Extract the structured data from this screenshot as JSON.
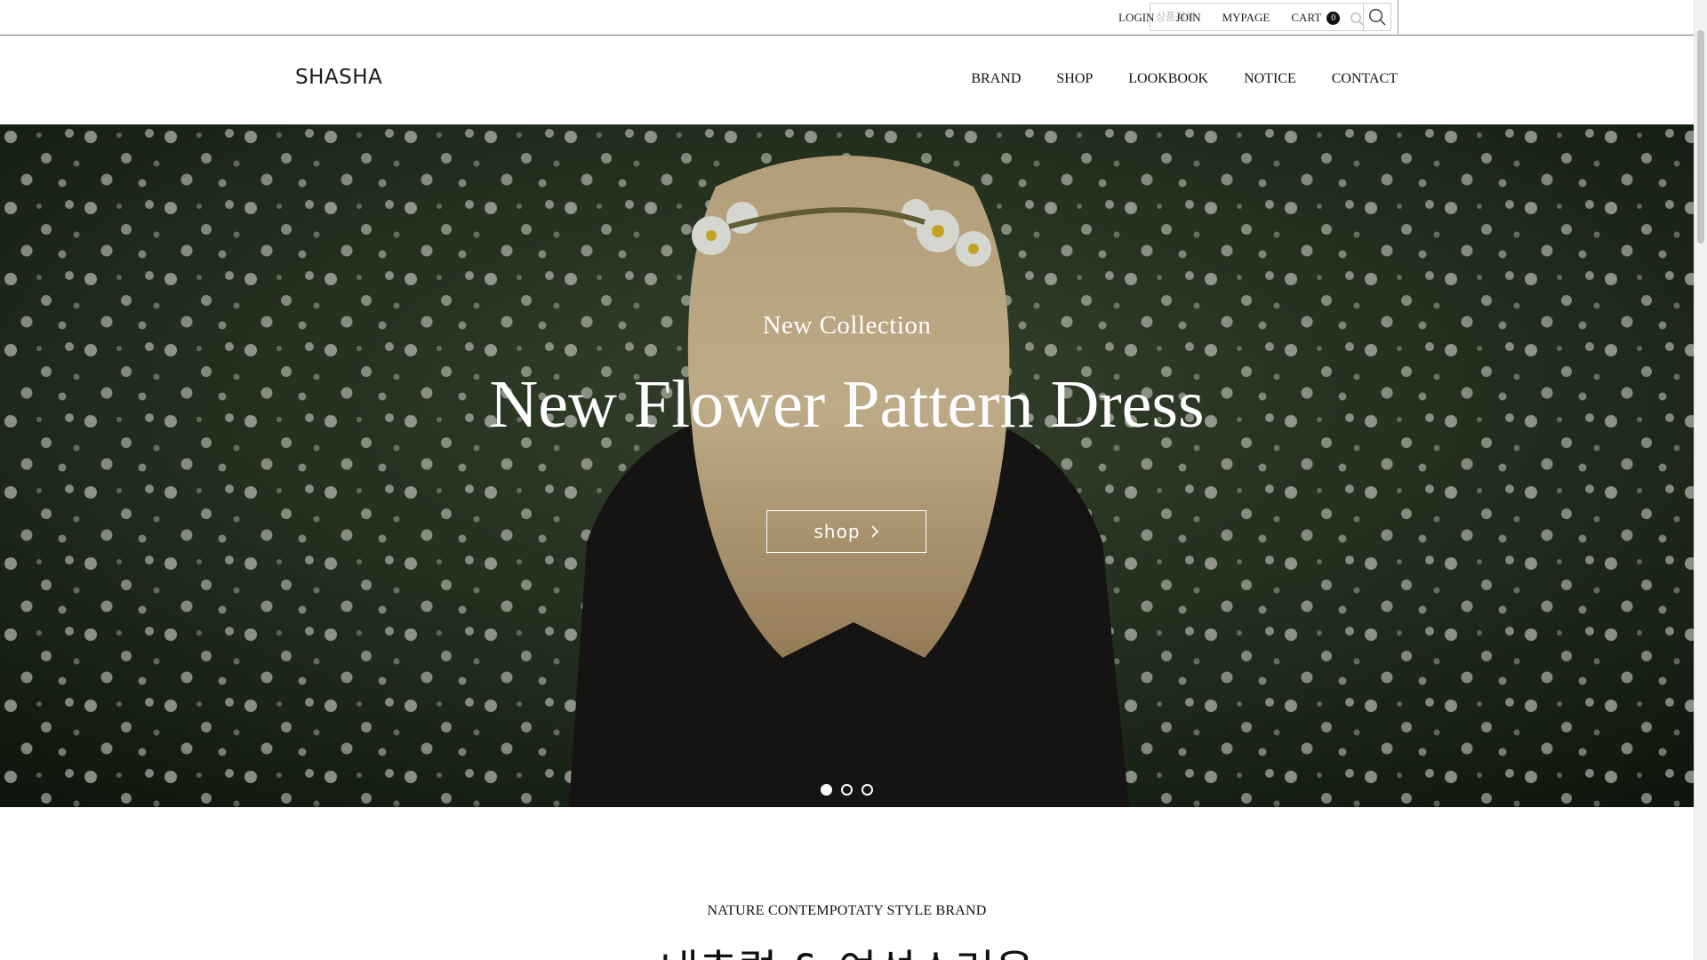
{
  "topbar": {
    "login": "LOGIN",
    "join": "JOIN",
    "mypage": "MYPAGE",
    "cart": "CART",
    "cart_count": "0",
    "search_placeholder": "상품검색",
    "icons": [
      "search-icon",
      "magnifier-icon"
    ]
  },
  "header": {
    "logo": "SHASHA",
    "nav": [
      "BRAND",
      "SHOP",
      "LOOKBOOK",
      "NOTICE",
      "CONTACT"
    ]
  },
  "hero": {
    "subtitle": "New Collection",
    "title": "New Flower Pattern Dress",
    "button_label": "shop",
    "button_icon": "chevron-right-icon",
    "slides_total": 3,
    "active_slide": 1
  },
  "intro": {
    "tagline": "NATURE CONTEMPOTATY STYLE BRAND",
    "heading": "내추럴 & 여성스러운"
  },
  "colors": {
    "text": "#111111",
    "hero_overlay": "#1e2a1b",
    "white": "#ffffff"
  }
}
